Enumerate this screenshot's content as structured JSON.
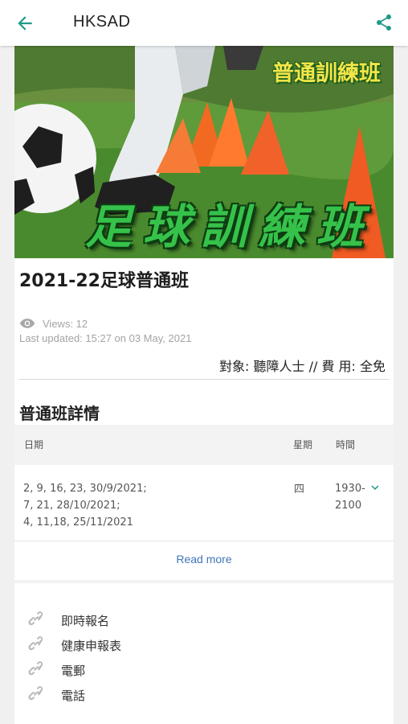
{
  "header": {
    "title": "HKSAD",
    "back_icon": "arrow-left-icon",
    "share_icon": "share-icon",
    "accent_color": "#1f9a8a"
  },
  "hero": {
    "tag": "普通訓練班",
    "headline": "足球訓練班"
  },
  "post": {
    "title": "2021-22足球普通班",
    "views": "Views: 12",
    "last_updated": "Last updated: 15:27 on 03 May, 2021",
    "target_fee": "對象: 聽障人士  //  費 用: 全免"
  },
  "schedule": {
    "title": "普通班詳情",
    "columns": [
      "日期",
      "星期",
      "時間"
    ],
    "rows": [
      {
        "date": "2, 9, 16, 23, 30/9/2021;\n7, 21, 28/10/2021;\n4, 11,18, 25/11/2021",
        "day": "四",
        "time": "1930-\n2100"
      }
    ],
    "read_more": "Read more"
  },
  "links": [
    {
      "label": "即時報名",
      "icon": "link-icon"
    },
    {
      "label": "健康申報表",
      "icon": "link-icon"
    },
    {
      "label": "電郵",
      "icon": "link-icon"
    },
    {
      "label": "電話",
      "icon": "link-icon"
    }
  ]
}
